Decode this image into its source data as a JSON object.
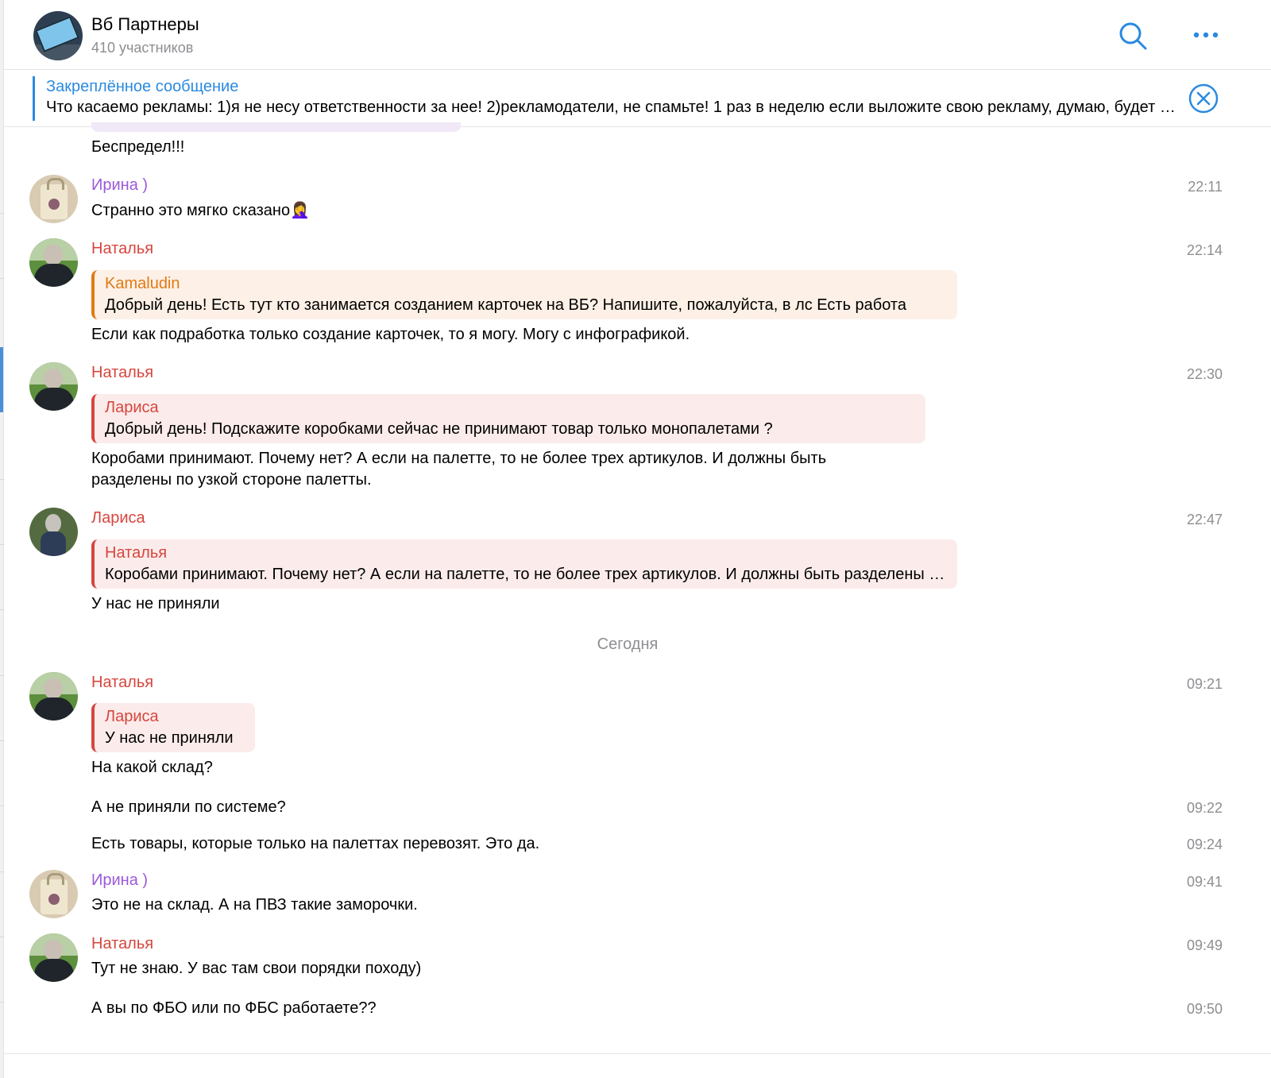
{
  "header": {
    "title": "Вб Партнеры",
    "subtitle": "410 участников",
    "avatar_icon": "marketplace-keyboard",
    "search_icon": "search-icon",
    "more_icon": "more-icon"
  },
  "pinned": {
    "title": "Закреплённое сообщение",
    "text": "Что касаемо рекламы:  1)я не несу ответственности за нее!  2)рекламодатели, не спамьте! 1 раз в неделю если выложите свою рекламу, думаю, будет нормально",
    "close_icon": "close-circle-icon"
  },
  "colors": {
    "accent": "#2a8ae0",
    "name_red": "#d6463e",
    "name_purple": "#9b59d9",
    "name_orange": "#e07a14"
  },
  "messages": [
    {
      "text": "Беспредел!!!"
    },
    {
      "author": "Ирина )",
      "time": "22:11",
      "text": "Странно это мягко сказано🤦‍♀️"
    },
    {
      "author": "Наталья",
      "time": "22:14",
      "reply_author": "Kamaludin",
      "reply_text": "Добрый день! Есть тут кто занимается созданием карточек на ВБ? Напишите, пожалуйста, в лс Есть работа",
      "text": "Если как подработка только создание карточек, то я могу. Могу с инфографикой."
    },
    {
      "author": "Наталья",
      "time": "22:30",
      "reply_author": "Лариса",
      "reply_text": "Добрый день! Подскажите коробками сейчас не принимают товар только монопалетами ?",
      "text_line1": "Коробами принимают. Почему нет? А если на палетте, то не более трех артикулов. И должны быть",
      "text_line2": "разделены по узкой стороне палетты."
    },
    {
      "author": "Лариса",
      "time": "22:47",
      "reply_author": "Наталья",
      "reply_text": "Коробами принимают. Почему нет? А если на палетте, то не более трех артикулов. И должны быть разделены по узкой стороне палетты.",
      "text": "У нас не приняли"
    },
    {
      "date_separator": "Сегодня"
    },
    {
      "author": "Наталья",
      "time": "09:21",
      "reply_author": "Лариса",
      "reply_text": "У нас не приняли",
      "text": "На какой склад?"
    },
    {
      "time": "09:22",
      "text": "А не приняли по системе?"
    },
    {
      "time": "09:24",
      "text": "Есть товары, которые только на палеттах перевозят. Это да."
    },
    {
      "author": "Ирина )",
      "time": "09:41",
      "text": "Это не на склад. А на ПВЗ такие заморочки."
    },
    {
      "author": "Наталья",
      "time": "09:49",
      "text": "Тут не знаю. У вас там свои порядки походу)"
    },
    {
      "time": "09:50",
      "text": "А вы по ФБО  или по ФБС работаете??"
    }
  ]
}
